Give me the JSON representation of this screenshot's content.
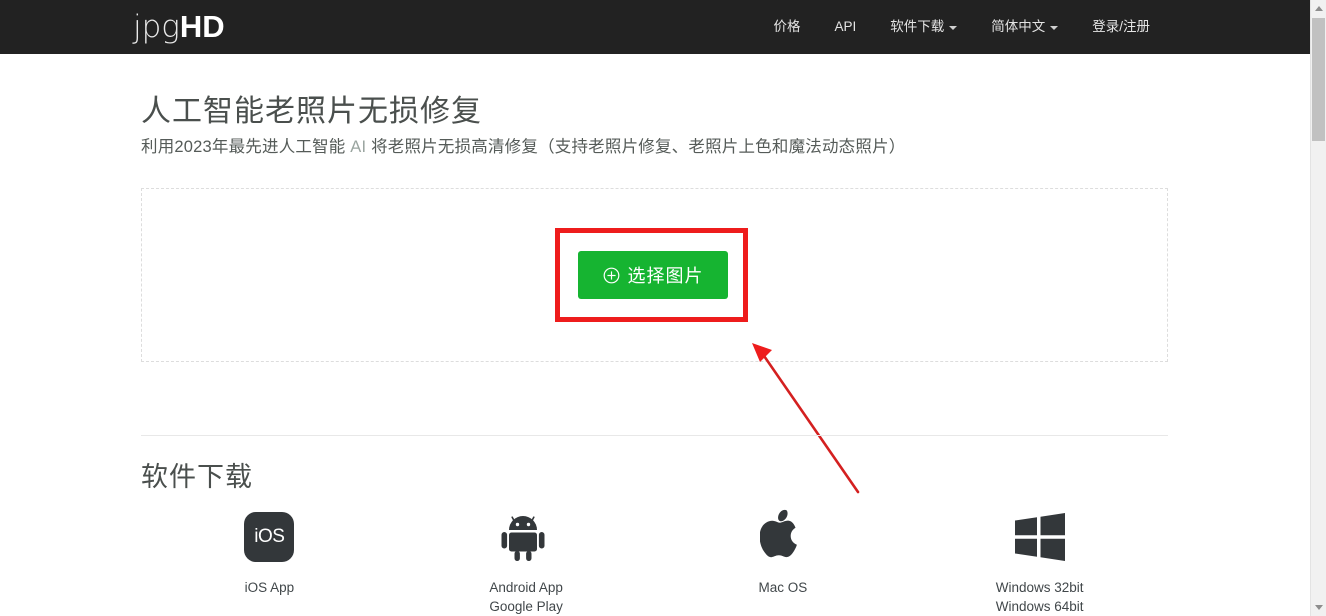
{
  "site": {
    "logo_light": "jpg",
    "logo_bold": "HD"
  },
  "nav": {
    "items": [
      {
        "label": "价格",
        "has_caret": false
      },
      {
        "label": "API",
        "has_caret": false
      },
      {
        "label": "软件下载",
        "has_caret": true
      },
      {
        "label": "简体中文",
        "has_caret": true
      },
      {
        "label": "登录/注册",
        "has_caret": false
      }
    ]
  },
  "hero": {
    "title": "人工智能老照片无损修复",
    "subtitle_pre": "利用2023年最先进人工智能 ",
    "subtitle_ai": "AI",
    "subtitle_post": " 将老照片无损高清修复（支持老照片修复、老照片上色和魔法动态照片）"
  },
  "uploader": {
    "select_button_label": "选择图片",
    "select_button_icon": "plus-circle-icon",
    "button_color": "#16b431"
  },
  "annotation": {
    "highlight_color": "#ee1c1c",
    "box_target": "选择图片",
    "arrow_points_to": "选择图片"
  },
  "downloads": {
    "section_title": "软件下载",
    "items": [
      {
        "icon": "ios-icon",
        "icon_text": "iOS",
        "label_line1": "iOS App",
        "label_line2": ""
      },
      {
        "icon": "android-icon",
        "icon_text": "",
        "label_line1": "Android App",
        "label_line2": "Google Play"
      },
      {
        "icon": "apple-icon",
        "icon_text": "",
        "label_line1": "Mac OS",
        "label_line2": ""
      },
      {
        "icon": "windows-icon",
        "icon_text": "",
        "label_line1": "Windows 32bit",
        "label_line2": "Windows 64bit"
      }
    ]
  },
  "scrollbar": {
    "up_arrow": "scroll-up-arrow",
    "down_arrow": "scroll-down-arrow"
  }
}
